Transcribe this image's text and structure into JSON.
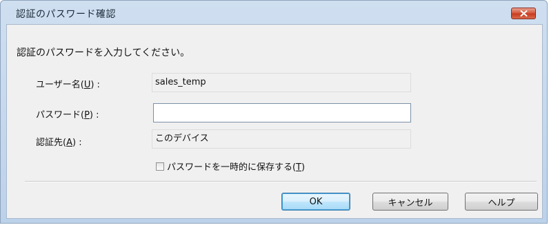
{
  "window": {
    "title": "認証のパスワード確認"
  },
  "dialog": {
    "prompt": "認証のパスワードを入力してください。",
    "fields": {
      "username": {
        "label_prefix": "ユーザー名(",
        "label_mnemonic": "U",
        "label_suffix": ") :",
        "value": "sales_temp"
      },
      "password": {
        "label_prefix": "パスワード(",
        "label_mnemonic": "P",
        "label_suffix": ") :",
        "value": ""
      },
      "destination": {
        "label_prefix": "認証先(",
        "label_mnemonic": "A",
        "label_suffix": ") :",
        "value": "このデバイス"
      }
    },
    "save_password": {
      "label": "パスワードを一時的に保存する(",
      "mnemonic": "T",
      "suffix": ")",
      "checked": false
    }
  },
  "buttons": {
    "ok": "OK",
    "cancel": "キャンセル",
    "help": "ヘルプ"
  },
  "icons": {
    "close": "close-icon"
  },
  "colors": {
    "close_button": "#c63a20",
    "default_button_border": "#3c7fb1",
    "client_background": "#f0f0f0",
    "titlebar": "#c4d7ec"
  }
}
